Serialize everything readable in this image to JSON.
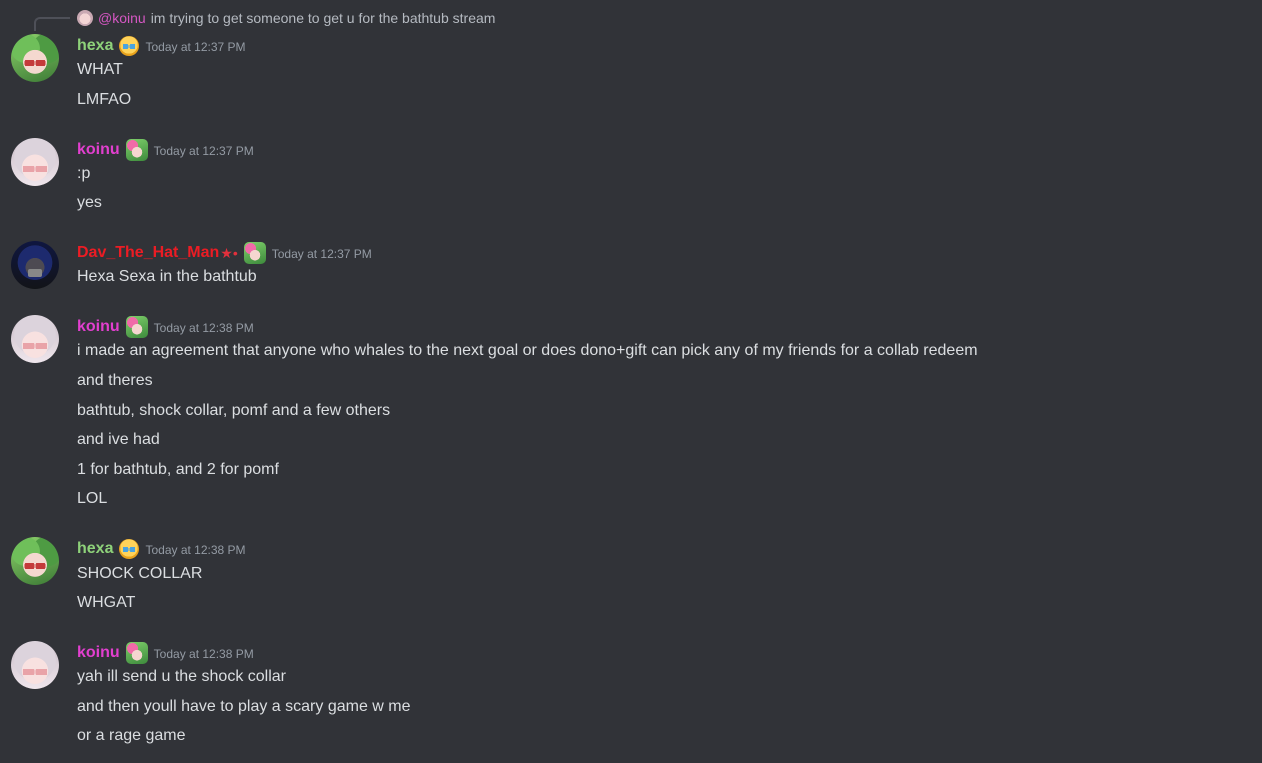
{
  "reply": {
    "mention": "@koinu",
    "text": "im trying to get someone to get u for the bathtub stream"
  },
  "messages": [
    {
      "author": "hexa",
      "timestamp": "Today at 12:37 PM",
      "lines": [
        "WHAT",
        "LMFAO"
      ]
    },
    {
      "author": "koinu",
      "timestamp": "Today at 12:37 PM",
      "lines": [
        ":p",
        "yes"
      ]
    },
    {
      "author": "Dav_The_Hat_Man",
      "author_decoration": "★•",
      "timestamp": "Today at 12:37 PM",
      "lines": [
        "Hexa Sexa in the bathtub"
      ]
    },
    {
      "author": "koinu",
      "timestamp": "Today at 12:38 PM",
      "lines": [
        "i made an agreement that anyone who whales to the next goal or does dono+gift can pick any of my friends for a collab redeem",
        "and theres",
        "bathtub, shock collar, pomf and a few others",
        "and ive had",
        "1 for bathtub, and 2 for pomf",
        "LOL"
      ]
    },
    {
      "author": "hexa",
      "timestamp": "Today at 12:38 PM",
      "lines": [
        "SHOCK COLLAR",
        "WHGAT"
      ]
    },
    {
      "author": "koinu",
      "timestamp": "Today at 12:38 PM",
      "lines": [
        "yah ill send u the shock collar",
        "and then youll have to play a scary game w me",
        "or a rage game"
      ]
    }
  ],
  "colors": {
    "background": "#313338",
    "hexa_name": "#8ed27a",
    "koinu_name": "#e23fcf",
    "dav_name": "#ec1c24",
    "timestamp": "#949ba4",
    "text": "#dbdee1"
  }
}
